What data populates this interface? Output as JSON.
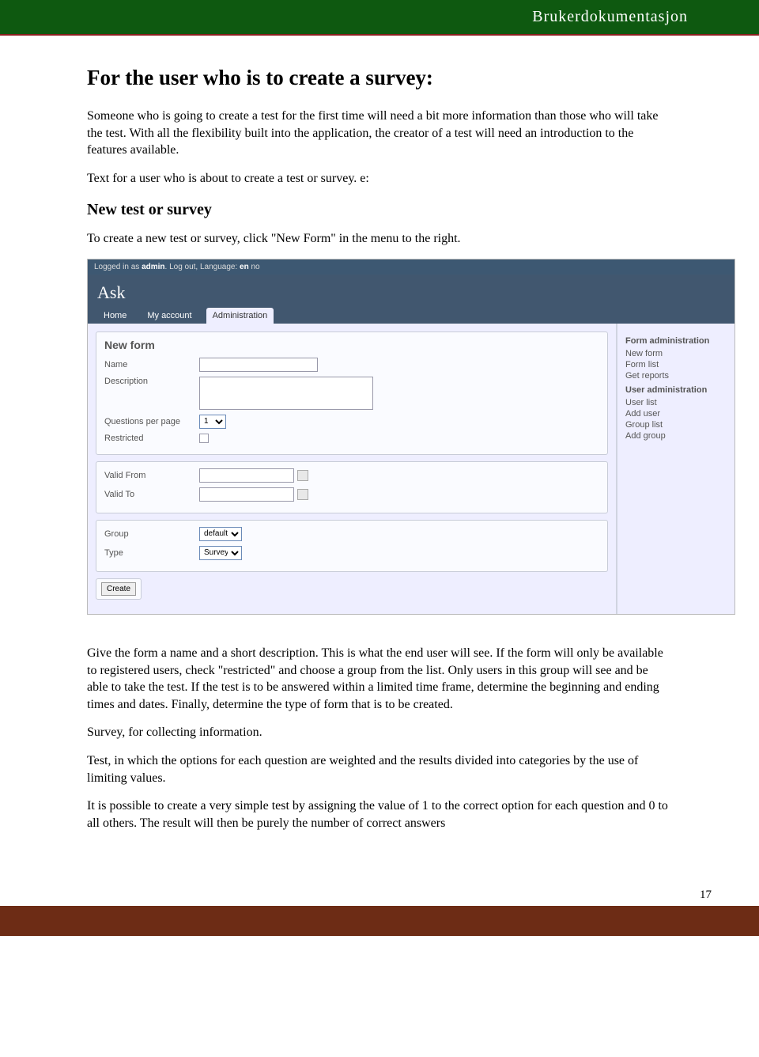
{
  "header": {
    "title": "Brukerdokumentasjon"
  },
  "doc": {
    "h1": "For the user who is to create a survey:",
    "p1": "Someone who is going to create a test for the first time will need a bit more information than those who will take the test. With all the flexibility built into the application, the creator of a test will need an introduction to the features available.",
    "p2": "Text for a user who is about to create a test or survey. e:",
    "h2": "New test or survey",
    "p3": "To create a new test or survey, click \"New Form\" in the menu to the right.",
    "p4": "Give the form a name and a short description. This is what the end user will see. If the form will only be available to registered users, check \"restricted\" and choose a group from the list. Only users in this group will see and be able to take the test. If the test is to be answered within a limited time frame, determine the beginning and ending times and dates. Finally, determine the type of form that is to be created.",
    "p5": "Survey, for collecting information.",
    "p6": "Test, in which the options for each question are weighted and the results divided into categories by the use of limiting values.",
    "p7": "It is possible to create a very simple test by assigning the value of 1 to the correct option for each question and 0 to all others. The result will then be purely the number of correct answers"
  },
  "ss": {
    "topbar_prefix": "Logged in as ",
    "topbar_user": "admin",
    "topbar_logout": ". Log out,",
    "topbar_lang": " Language: ",
    "topbar_en": "en",
    "topbar_no": " no",
    "logo": "Ask",
    "nav": {
      "home": "Home",
      "account": "My account",
      "admin": "Administration"
    },
    "panel_title": "New form",
    "labels": {
      "name": "Name",
      "description": "Description",
      "questions": "Questions per page",
      "restricted": "Restricted",
      "valid_from": "Valid From",
      "valid_to": "Valid To",
      "group": "Group",
      "type": "Type"
    },
    "questions_value": "1",
    "group_value": "default",
    "type_value": "Survey",
    "create_btn": "Create",
    "side": {
      "form_admin": "Form administration",
      "new_form": "New form",
      "form_list": "Form list",
      "get_reports": "Get reports",
      "user_admin": "User administration",
      "user_list": "User list",
      "add_user": "Add user",
      "group_list": "Group list",
      "add_group": "Add group"
    }
  },
  "page_number": "17"
}
